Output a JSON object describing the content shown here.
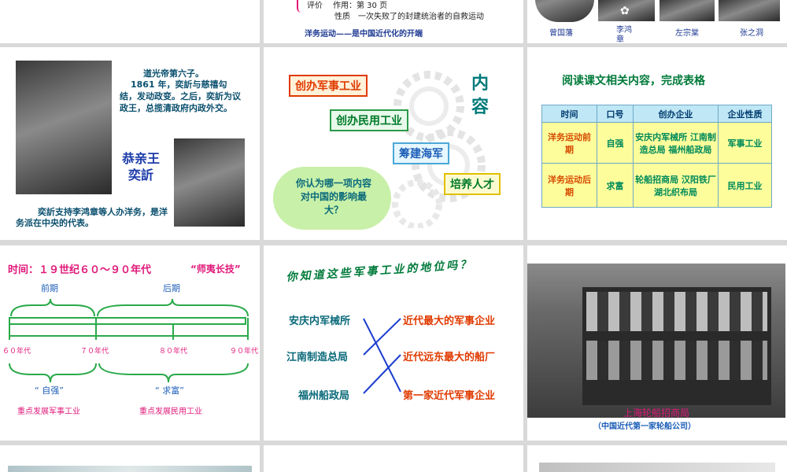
{
  "s1": {
    "rows": [
      {
        "label": "评价",
        "content": "作用：第 30 页"
      },
      {
        "label": "性质",
        "content": "一次失败了的封建统治者的自救运动"
      }
    ],
    "conclusion": "洋务运动——是中国近代化的开端"
  },
  "s2": {
    "names": [
      "曾国藩",
      "李鸿章",
      "左宗棠",
      "张之洞"
    ]
  },
  "s3": {
    "bio_line1": "道光帝第六子。",
    "bio_rest": "1861 年，奕訢与慈禧勾结，发动政变。之后，奕訢为议政王，总揽清政府内政外交。",
    "name_line1": "恭亲王",
    "name_line2": "奕訢",
    "caption": "奕訢支持李鸿章等人办洋务，是洋务派在中央的代表。"
  },
  "s4": {
    "items": [
      "创办军事工业",
      "创办民用工业",
      "筹建海军",
      "培养人才"
    ],
    "title_chars": [
      "内",
      "容"
    ],
    "question": "你认为哪一项内容对中国的影响最大？"
  },
  "s5": {
    "heading": "阅读课文相关内容，完成表格",
    "headers": [
      "时间",
      "口号",
      "创办企业",
      "企业性质"
    ],
    "rows": [
      {
        "time": "洋务运动前期",
        "slogan": "自强",
        "companies": "安庆内军械所 江南制造总局 福州船政局",
        "nature": "军事工业"
      },
      {
        "time": "洋务运动后期",
        "slogan": "求富",
        "companies": "轮船招商局 汉阳铁厂 湖北织布局",
        "nature": "民用工业"
      }
    ]
  },
  "s6": {
    "title": "时间：１９世纪６０～９０年代",
    "quote": "“师夷长技”",
    "early": "前期",
    "late": "后期",
    "ticks": [
      "６０年代",
      "７０年代",
      "８０年代",
      "９０年代"
    ],
    "slogan1": "“ 自强”",
    "slogan2": "“ 求富”",
    "focus1": "重点发展军事工业",
    "focus2": "重点发展民用工业"
  },
  "s7": {
    "question": "你知道这些军事工业的地位吗？",
    "left": [
      "安庆内军械所",
      "江南制造总局",
      "福州船政局"
    ],
    "right": [
      "近代最大的军事企业",
      "近代远东最大的船厂",
      "第一家近代军事企业"
    ]
  },
  "s8": {
    "caption": "上海轮船招商局",
    "subcaption": "（中国近代第一家轮船公司）"
  },
  "colors": {
    "teal": "#00857a",
    "navy": "#1f3a93",
    "magenta": "#e0197a",
    "orange": "#e03a00",
    "blue": "#1d5fb8"
  }
}
